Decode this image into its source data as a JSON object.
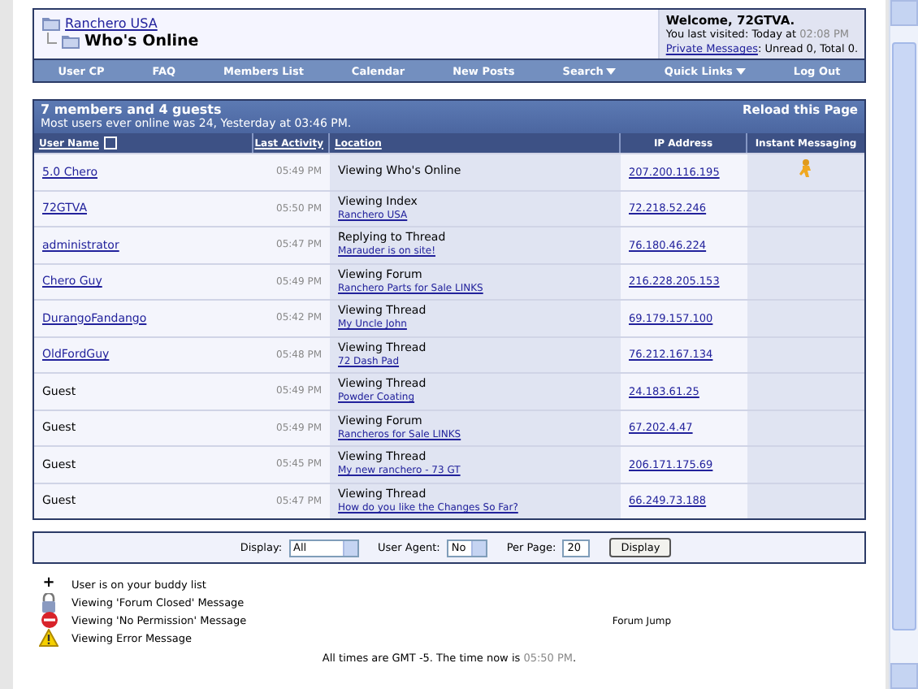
{
  "breadcrumb": {
    "parent": "Ranchero USA",
    "current": "Who's Online"
  },
  "welcome": {
    "title": "Welcome, 72GTVA.",
    "visited_label": "You last visited: Today at",
    "visited_time": "02:08 PM",
    "pm_link": "Private Messages",
    "pm_counts": ": Unread 0, Total 0."
  },
  "navbar": [
    {
      "label": "User CP",
      "has_menu": false
    },
    {
      "label": "FAQ",
      "has_menu": false
    },
    {
      "label": "Members List",
      "has_menu": false
    },
    {
      "label": "Calendar",
      "has_menu": false
    },
    {
      "label": "New Posts",
      "has_menu": false
    },
    {
      "label": "Search",
      "has_menu": true
    },
    {
      "label": "Quick Links",
      "has_menu": true
    },
    {
      "label": "Log Out",
      "has_menu": false
    }
  ],
  "online": {
    "title": "7 members and 4 guests",
    "subtitle": "Most users ever online was 24, Yesterday at 03:46 PM.",
    "reload": "Reload this Page",
    "columns": [
      "User Name",
      "Last Activity",
      "Location",
      "IP Address",
      "Instant Messaging"
    ],
    "rows": [
      {
        "user": "5.0 Chero",
        "member": true,
        "time": "05:49 PM",
        "action": "Viewing Who's Online",
        "ip": "207.200.116.195",
        "im": true
      },
      {
        "user": "72GTVA",
        "member": true,
        "time": "05:50 PM",
        "action": "Viewing Index",
        "target": "Ranchero USA",
        "ip": "72.218.52.246",
        "im": false
      },
      {
        "user": "administrator",
        "member": true,
        "time": "05:47 PM",
        "action": "Replying to Thread",
        "target": "Marauder is on site!",
        "ip": "76.180.46.224",
        "im": false
      },
      {
        "user": "Chero Guy",
        "member": true,
        "time": "05:49 PM",
        "action": "Viewing Forum",
        "target": "Ranchero Parts for Sale LINKS",
        "ip": "216.228.205.153",
        "im": false
      },
      {
        "user": "DurangoFandango",
        "member": true,
        "time": "05:42 PM",
        "action": "Viewing Thread",
        "target": "My Uncle John",
        "ip": "69.179.157.100",
        "im": false
      },
      {
        "user": "OldFordGuy",
        "member": true,
        "time": "05:48 PM",
        "action": "Viewing Thread",
        "target": "72 Dash Pad",
        "ip": "76.212.167.134",
        "im": false
      },
      {
        "user": "Guest",
        "member": false,
        "time": "05:49 PM",
        "action": "Viewing Thread",
        "target": "Powder Coating",
        "ip": "24.183.61.25",
        "im": false
      },
      {
        "user": "Guest",
        "member": false,
        "time": "05:49 PM",
        "action": "Viewing Forum",
        "target": "Rancheros for Sale LINKS",
        "ip": "67.202.4.47",
        "im": false
      },
      {
        "user": "Guest",
        "member": false,
        "time": "05:45 PM",
        "action": "Viewing Thread",
        "target": "My new ranchero - 73 GT",
        "ip": "206.171.175.69",
        "im": false
      },
      {
        "user": "Guest",
        "member": false,
        "time": "05:47 PM",
        "action": "Viewing Thread",
        "target": "How do you like the Changes So Far?",
        "ip": "66.249.73.188",
        "im": false
      }
    ]
  },
  "filters": {
    "display_label": "Display:",
    "display_value": "All",
    "agent_label": "User Agent:",
    "agent_value": "No",
    "per_page_label": "Per Page:",
    "per_page_value": "20",
    "button": "Display"
  },
  "legend": [
    {
      "kind": "buddy",
      "icon": "+",
      "text": "User is on your buddy list"
    },
    {
      "kind": "closed",
      "text": "Viewing 'Forum Closed' Message"
    },
    {
      "kind": "nopermission",
      "text": "Viewing 'No Permission' Message"
    },
    {
      "kind": "error",
      "text": "Viewing Error Message"
    }
  ],
  "forum_jump": "Forum Jump",
  "footer": {
    "before": "All times are GMT -5. The time now is",
    "time": "05:50 PM",
    "after": "."
  }
}
